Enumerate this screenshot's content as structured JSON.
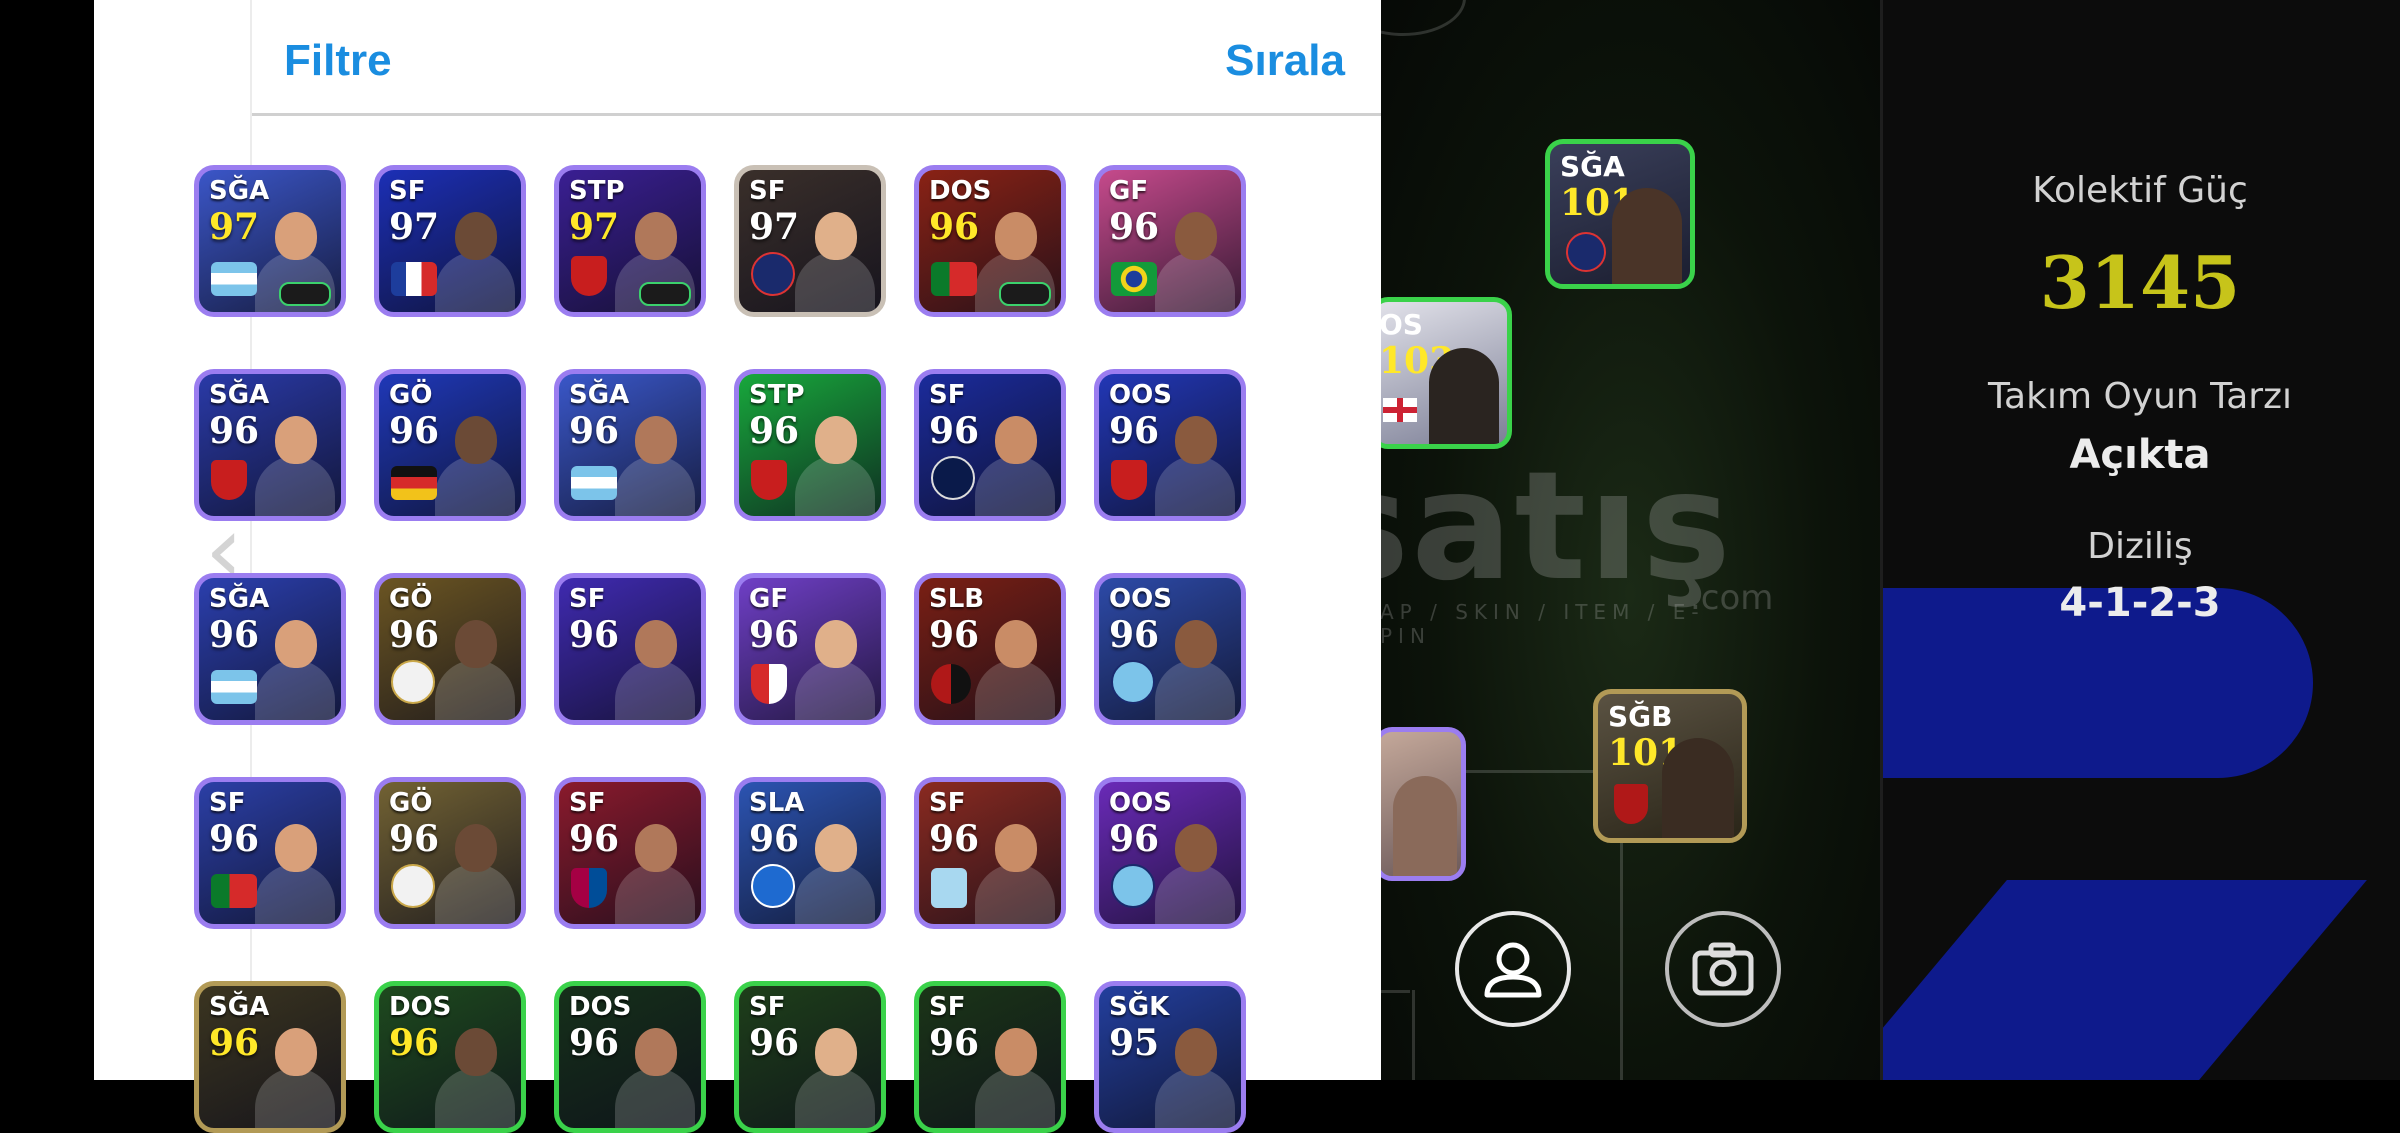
{
  "header": {
    "filter_label": "Filtre",
    "sort_label": "Sırala"
  },
  "collapse_icon": "chevron-left-icon",
  "player_cards": [
    {
      "position": "SĞA",
      "rating": "97",
      "rating_color": "#ffe829",
      "bg": "#3b56c8",
      "frame": "#9b7df0",
      "badge": "flag-argentina"
    },
    {
      "position": "SF",
      "rating": "97",
      "rating_color": "#ffffff",
      "bg": "#1c2fb6",
      "frame": "#9b7df0",
      "badge": "flag-france"
    },
    {
      "position": "STP",
      "rating": "97",
      "rating_color": "#ffe829",
      "bg": "#3a1f93",
      "frame": "#9b7df0",
      "badge": "crest-arsenal"
    },
    {
      "position": "SF",
      "rating": "97",
      "rating_color": "#ffffff",
      "bg": "#3a2f2a",
      "frame": "#c9c0b5",
      "badge": "crest-psg"
    },
    {
      "position": "DOS",
      "rating": "96",
      "rating_color": "#ffe829",
      "bg": "#8a2215",
      "frame": "#9b7df0",
      "badge": "flag-portugal"
    },
    {
      "position": "GF",
      "rating": "96",
      "rating_color": "#ffffff",
      "bg": "#c64a8c",
      "frame": "#9b7df0",
      "badge": "flag-brazil"
    },
    {
      "position": "SĞA",
      "rating": "96",
      "rating_color": "#ffffff",
      "bg": "#2a3aa8",
      "frame": "#9b7df0",
      "badge": "crest-arsenal"
    },
    {
      "position": "GÖ",
      "rating": "96",
      "rating_color": "#ffffff",
      "bg": "#1f38b8",
      "frame": "#9b7df0",
      "badge": "flag-germany"
    },
    {
      "position": "SĞA",
      "rating": "96",
      "rating_color": "#ffffff",
      "bg": "#3a57c9",
      "frame": "#9b7df0",
      "badge": "flag-argentina"
    },
    {
      "position": "STP",
      "rating": "96",
      "rating_color": "#ffffff",
      "bg": "#18a83c",
      "frame": "#9b7df0",
      "badge": "crest-arsenal"
    },
    {
      "position": "SF",
      "rating": "96",
      "rating_color": "#ffffff",
      "bg": "#1b2b9c",
      "frame": "#9b7df0",
      "badge": "crest-inter"
    },
    {
      "position": "OOS",
      "rating": "96",
      "rating_color": "#ffffff",
      "bg": "#2237b6",
      "frame": "#9b7df0",
      "badge": "crest-arsenal"
    },
    {
      "position": "SĞA",
      "rating": "96",
      "rating_color": "#ffffff",
      "bg": "#2b3fae",
      "frame": "#9b7df0",
      "badge": "flag-argentina"
    },
    {
      "position": "GÖ",
      "rating": "96",
      "rating_color": "#ffffff",
      "bg": "#6b5522",
      "frame": "#9b7df0",
      "badge": "crest-madrid"
    },
    {
      "position": "SF",
      "rating": "96",
      "rating_color": "#ffffff",
      "bg": "#3f2ab0",
      "frame": "#9b7df0",
      "badge": "none"
    },
    {
      "position": "GF",
      "rating": "96",
      "rating_color": "#ffffff",
      "bg": "#6f3fc6",
      "frame": "#9b7df0",
      "badge": "crest-atletico"
    },
    {
      "position": "SLB",
      "rating": "96",
      "rating_color": "#ffffff",
      "bg": "#7a1f14",
      "frame": "#9b7df0",
      "badge": "crest-milan"
    },
    {
      "position": "OOS",
      "rating": "96",
      "rating_color": "#ffffff",
      "bg": "#2d4aa8",
      "frame": "#9b7df0",
      "badge": "crest-city"
    },
    {
      "position": "SF",
      "rating": "96",
      "rating_color": "#ffffff",
      "bg": "#2b3fa6",
      "frame": "#9b7df0",
      "badge": "flag-portugal"
    },
    {
      "position": "GÖ",
      "rating": "96",
      "rating_color": "#ffffff",
      "bg": "#726233",
      "frame": "#9b7df0",
      "badge": "crest-madrid"
    },
    {
      "position": "SF",
      "rating": "96",
      "rating_color": "#ffffff",
      "bg": "#8a1a2c",
      "frame": "#9b7df0",
      "badge": "crest-barcelona"
    },
    {
      "position": "SLA",
      "rating": "96",
      "rating_color": "#ffffff",
      "bg": "#2c54b2",
      "frame": "#9b7df0",
      "badge": "crest-napoli"
    },
    {
      "position": "SF",
      "rating": "96",
      "rating_color": "#ffffff",
      "bg": "#8a2a20",
      "frame": "#9b7df0",
      "badge": "crest-lazio"
    },
    {
      "position": "OOS",
      "rating": "96",
      "rating_color": "#ffffff",
      "bg": "#6a2ab8",
      "frame": "#9b7df0",
      "badge": "crest-city"
    },
    {
      "position": "SĞA",
      "rating": "96",
      "rating_color": "#ffe829",
      "bg": "#3b3520",
      "frame": "#b29a56",
      "badge": "none"
    },
    {
      "position": "DOS",
      "rating": "96",
      "rating_color": "#ffe829",
      "bg": "#1e4a1e",
      "frame": "#3ad24a",
      "badge": "none"
    },
    {
      "position": "DOS",
      "rating": "96",
      "rating_color": "#ffffff",
      "bg": "#16301a",
      "frame": "#3ad24a",
      "badge": "none"
    },
    {
      "position": "SF",
      "rating": "96",
      "rating_color": "#ffffff",
      "bg": "#1e3f1a",
      "frame": "#3ad24a",
      "badge": "none"
    },
    {
      "position": "SF",
      "rating": "96",
      "rating_color": "#ffffff",
      "bg": "#1b3518",
      "frame": "#3ad24a",
      "badge": "none"
    },
    {
      "position": "SĞK",
      "rating": "95",
      "rating_color": "#ffffff",
      "bg": "#233f9e",
      "frame": "#9b7df0",
      "badge": "none"
    }
  ],
  "pitch_players": [
    {
      "position": "SĞA",
      "rating": "101",
      "rating_color": "#ffe829"
    },
    {
      "position": "OS",
      "rating": "103",
      "rating_color": "#ffe829"
    },
    {
      "position": "SĞB",
      "rating": "101",
      "rating_color": "#ffe829"
    }
  ],
  "watermark": {
    "main": "satış",
    "sub": "AP / SKIN / ITEM / E-PIN",
    "suffix": ".com"
  },
  "stats": {
    "collective_label": "Kolektif Güç",
    "collective_value": "3145",
    "playstyle_label": "Takım Oyun Tarzı",
    "playstyle_value": "Açıkta",
    "formation_label": "Diziliş",
    "formation_value": "4-1-2-3"
  },
  "colors": {
    "accent_blue": "#1a8de0",
    "collective_value": "#c7c41a",
    "pitch_green": "#3ad24a"
  },
  "bottom_buttons": [
    "user-profile-icon",
    "camera-icon"
  ]
}
